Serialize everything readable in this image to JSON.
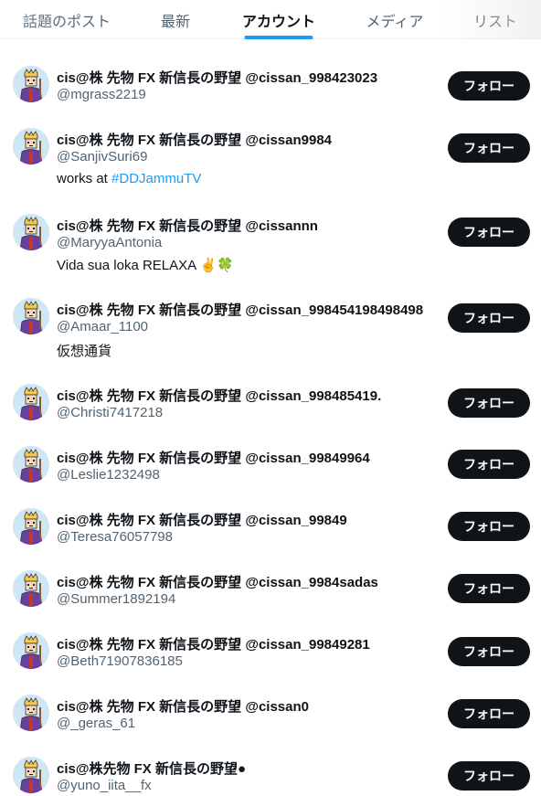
{
  "tabs": [
    {
      "label": "話題のポスト",
      "active": false
    },
    {
      "label": "最新",
      "active": false
    },
    {
      "label": "アカウント",
      "active": true
    },
    {
      "label": "メディア",
      "active": false
    },
    {
      "label": "リスト",
      "active": false
    }
  ],
  "colors": {
    "accent": "#1d9bf0",
    "text": "#0f1419",
    "muted": "#536471",
    "follow_bg": "#0f1419"
  },
  "accounts": [
    {
      "name": "cis@株 先物 FX 新信長の野望 @cissan_998423023",
      "handle": "@mgrass2219",
      "follow_label": "フォロー"
    },
    {
      "name": "cis@株 先物 FX 新信長の野望 @cissan9984",
      "handle": "@SanjivSuri69",
      "bio_text": "works at ",
      "bio_link": "#DDJammuTV",
      "follow_label": "フォロー"
    },
    {
      "name": "cis@株 先物 FX 新信長の野望 @cissannn",
      "handle": "@MaryyaAntonia",
      "bio_text": "Vida sua loka RELAXA ✌️🍀",
      "follow_label": "フォロー"
    },
    {
      "name": "cis@株 先物 FX 新信長の野望 @cissan_998454198498498",
      "handle": "@Amaar_1100",
      "bio_text": "仮想通貨",
      "follow_label": "フォロー"
    },
    {
      "name": "cis@株 先物 FX 新信長の野望 @cissan_998485419.",
      "handle": "@Christi7417218",
      "follow_label": "フォロー"
    },
    {
      "name": "cis@株 先物 FX 新信長の野望 @cissan_99849964",
      "handle": "@Leslie1232498",
      "follow_label": "フォロー"
    },
    {
      "name": "cis@株 先物 FX 新信長の野望 @cissan_99849",
      "handle": "@Teresa76057798",
      "follow_label": "フォロー"
    },
    {
      "name": "cis@株 先物 FX 新信長の野望 @cissan_9984sadas",
      "handle": "@Summer1892194",
      "follow_label": "フォロー"
    },
    {
      "name": "cis@株 先物 FX 新信長の野望 @cissan_99849281",
      "handle": "@Beth71907836185",
      "follow_label": "フォロー"
    },
    {
      "name": "cis@株 先物 FX 新信長の野望 @cissan0",
      "handle": "@_geras_61",
      "follow_label": "フォロー"
    },
    {
      "name": "cis@株先物 FX 新信長の野望●",
      "handle": "@yuno_iita__fx",
      "follow_label": "フォロー"
    }
  ]
}
